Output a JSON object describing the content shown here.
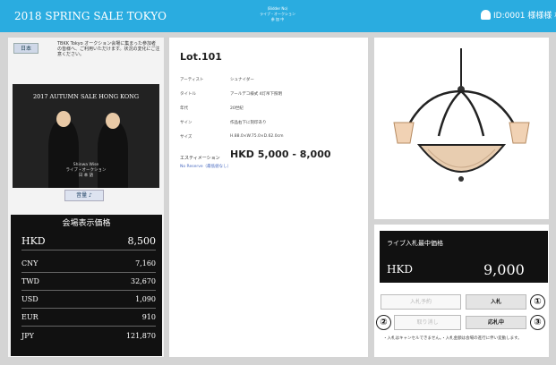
{
  "header": {
    "sale_title": "2018 SPRING SALE TOKYO",
    "center_line1": "(Bidder No)",
    "center_line2": "ライブ・オークション",
    "center_line3": "参 加 中",
    "user": "ID:0001 様様様 様"
  },
  "left": {
    "lang_button": "日本",
    "notice": "TBKK Tokyo オークション会場に集まった参加者の皆様へ、ご利用いただけます。状況の変化にご注意ください。",
    "video_title": "2017 AUTUMN SALE HONG KONG",
    "video_caption1": "Shinwa Wise",
    "video_caption2": "ライブ・オークション",
    "video_caption3": "日 本 語",
    "video_button": "音量 ♪",
    "prices_title": "会場表示価格",
    "prices": [
      {
        "cur": "HKD",
        "val": "8,500"
      },
      {
        "cur": "CNY",
        "val": "7,160"
      },
      {
        "cur": "TWD",
        "val": "32,670"
      },
      {
        "cur": "USD",
        "val": "1,090"
      },
      {
        "cur": "EUR",
        "val": "910"
      },
      {
        "cur": "JPY",
        "val": "121,870"
      }
    ]
  },
  "lot": {
    "title": "Lot.101",
    "specs": [
      {
        "label": "アーティスト",
        "value": "シュナイダー"
      },
      {
        "label": "タイトル",
        "value": "アールデコ様式 4灯吊下照明"
      },
      {
        "label": "年代",
        "value": "20世紀"
      },
      {
        "label": "サイン",
        "value": "作品右下に刻印あり"
      },
      {
        "label": "サイズ",
        "value": "H.88.0×W.75.0×D.62.0cm"
      }
    ],
    "estimate_label": "エスティメーション",
    "estimate_value": "HKD 5,000 - 8,000",
    "reserve": "No Reserve（最低値なし）"
  },
  "bid": {
    "live_title": "ライブ入札最中価格",
    "currency": "HKD",
    "value": "9,000",
    "btn_enter_amount": "入札予約",
    "btn_bid": "入札",
    "btn_cancel": "取り消し",
    "btn_status": "応札中",
    "marker1": "①",
    "marker2": "②",
    "marker3": "③",
    "note": "・入札はキャンセルできません。・入札金額は会場の進行に伴い変動します。"
  },
  "colors": {
    "header": "#2aace0",
    "panel_dark": "#111111"
  }
}
